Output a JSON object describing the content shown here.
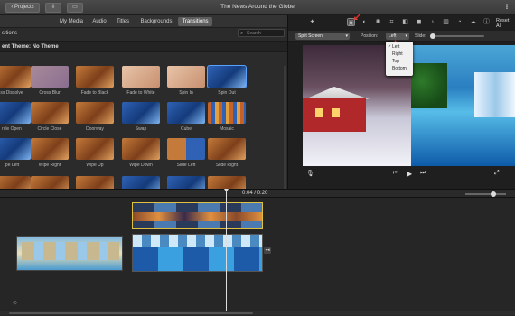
{
  "window": {
    "title": "The News Around the Globe",
    "projects_label": "Projects",
    "share_icon": "share-icon"
  },
  "tabs": [
    {
      "label": "My Media",
      "active": false
    },
    {
      "label": "Audio",
      "active": false
    },
    {
      "label": "Titles",
      "active": false
    },
    {
      "label": "Backgrounds",
      "active": false
    },
    {
      "label": "Transitions",
      "active": true
    }
  ],
  "browser": {
    "section_label": "sitions",
    "search_placeholder": "Search",
    "theme_label": "ent Theme: No Theme",
    "transitions": [
      {
        "label": "ss Dissolve",
        "style": "t-warm"
      },
      {
        "label": "Cross Blur",
        "style": "t-cross"
      },
      {
        "label": "Fade to Black",
        "style": "t-warm"
      },
      {
        "label": "Fade to White",
        "style": "t-pale"
      },
      {
        "label": "Spin In",
        "style": "t-pale"
      },
      {
        "label": "Spin Out",
        "style": "t-blue",
        "selected": true
      },
      {
        "label": "rcle Open",
        "style": "t-blue"
      },
      {
        "label": "Circle Close",
        "style": "t-warm"
      },
      {
        "label": "Doorway",
        "style": "t-warm"
      },
      {
        "label": "Swap",
        "style": "t-blue"
      },
      {
        "label": "Cube",
        "style": "t-blue"
      },
      {
        "label": "Mosaic",
        "style": "t-mosaic"
      },
      {
        "label": "ipe Left",
        "style": "t-blue"
      },
      {
        "label": "Wipe Right",
        "style": "t-warm"
      },
      {
        "label": "Wipe Up",
        "style": "t-warm"
      },
      {
        "label": "Wipe Down",
        "style": "t-warm"
      },
      {
        "label": "Slide Left",
        "style": "t-split"
      },
      {
        "label": "Slide Right",
        "style": "t-warm"
      },
      {
        "label": "",
        "style": "t-warm"
      },
      {
        "label": "",
        "style": "t-warm"
      },
      {
        "label": "",
        "style": "t-warm"
      },
      {
        "label": "",
        "style": "t-blue"
      },
      {
        "label": "",
        "style": "t-blue"
      },
      {
        "label": "",
        "style": "t-warm"
      }
    ]
  },
  "viewer": {
    "reset_all": "Reset All",
    "mode_dropdown": "Split Screen",
    "position_label": "Position:",
    "position_value": "Left",
    "slide_label": "Slide:",
    "position_menu": [
      {
        "label": "Left",
        "checked": true
      },
      {
        "label": "Right",
        "checked": false
      },
      {
        "label": "Top",
        "checked": false
      },
      {
        "label": "Bottom",
        "checked": false
      }
    ]
  },
  "timeline": {
    "timecode": "0:04",
    "separator": "/",
    "duration": "0:20"
  },
  "colors": {
    "accent": "#5aa0ff",
    "annotation_arrow": "#e8392d",
    "selection": "#e0c040"
  }
}
